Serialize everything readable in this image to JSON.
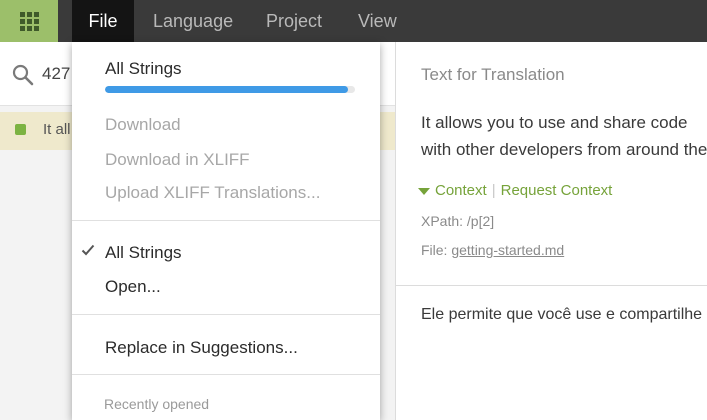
{
  "menubar": {
    "apps_icon": "apps-grid-icon",
    "items": [
      "File",
      "Language",
      "Project",
      "View"
    ]
  },
  "search": {
    "icon": "search-icon",
    "value": "427"
  },
  "string_list": {
    "row_text": "It all",
    "status_color": "#7cb342"
  },
  "dropdown": {
    "all_strings_label": "All Strings",
    "progress": 0.97,
    "progress_color": "#3f9ae6",
    "download": "Download",
    "download_xliff": "Download in XLIFF",
    "upload_xliff": "Upload XLIFF Translations...",
    "checked_all_strings": "All Strings",
    "check_icon": "checkmark-icon",
    "open": "Open...",
    "replace": "Replace in Suggestions...",
    "recently_opened": "Recently opened"
  },
  "details": {
    "title": "Text for Translation",
    "source_line1": "It allows you to use and share code",
    "source_line2": "with other developers from around the",
    "context_link": "Context",
    "request_context_link": "Request Context",
    "xpath": "XPath: /p[2]",
    "file_label": "File:",
    "file_name": "getting-started.md",
    "translation": "Ele permite que você use e compartilhe",
    "accent_color": "#76a33a"
  }
}
